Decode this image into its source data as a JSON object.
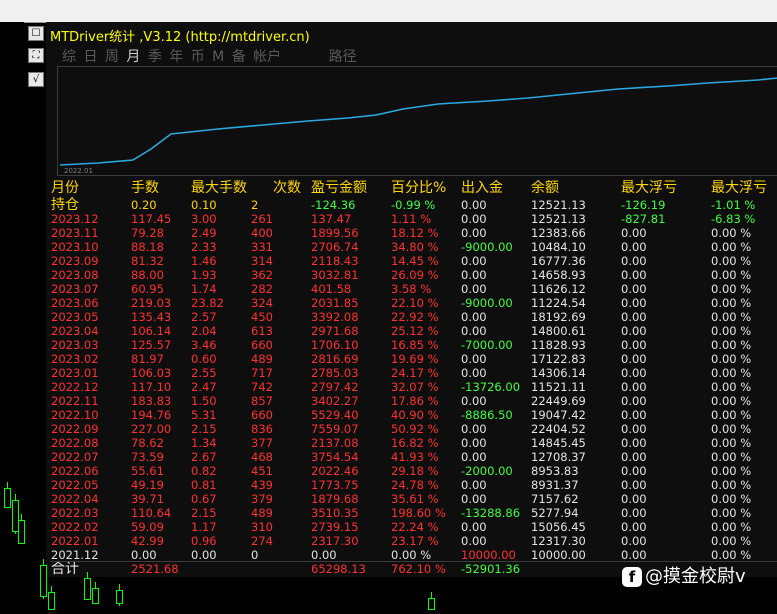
{
  "app": {
    "title": "MTDriver统计 ,V3.12 (http://mtdriver.cn)",
    "side_buttons": [
      "☐",
      "⛶",
      "√"
    ]
  },
  "tabs": [
    {
      "label": "综",
      "active": false
    },
    {
      "label": "日",
      "active": false
    },
    {
      "label": "周",
      "active": false
    },
    {
      "label": "月",
      "active": true
    },
    {
      "label": "季",
      "active": false
    },
    {
      "label": "年",
      "active": false
    },
    {
      "label": "币",
      "active": false
    },
    {
      "label": "M",
      "active": false
    },
    {
      "label": "备",
      "active": false
    },
    {
      "label": "帐户",
      "active": false
    },
    {
      "label": "路径",
      "active": false
    }
  ],
  "equity_chart": {
    "x_start_label": "2022.01",
    "line_color": "#29a9e0"
  },
  "table": {
    "columns": [
      "月份",
      "手数",
      "最大手数",
      "次数",
      "盈亏金额",
      "百分比%",
      "出入金",
      "余额",
      "最大浮亏",
      "最大浮亏"
    ],
    "open_row": {
      "label": "持仓",
      "lots": "0.20",
      "max_lots": "0.10",
      "count": "2",
      "pnl": "-124.36",
      "pct": "-0.99 %",
      "flow": "0.00",
      "balance": "12521.13",
      "max_float_loss": "-126.19",
      "max_float_loss_pct": "-1.01 %"
    },
    "rows": [
      {
        "month": "2023.12",
        "lots": "117.45",
        "max_lots": "3.00",
        "count": "261",
        "pnl": "137.47",
        "pct": "1.11 %",
        "flow": "0.00",
        "balance": "12521.13",
        "mfl": "-827.81",
        "mflp": "-6.83 %"
      },
      {
        "month": "2023.11",
        "lots": "79.28",
        "max_lots": "2.49",
        "count": "400",
        "pnl": "1899.56",
        "pct": "18.12 %",
        "flow": "0.00",
        "balance": "12383.66",
        "mfl": "0.00",
        "mflp": "0.00 %"
      },
      {
        "month": "2023.10",
        "lots": "88.18",
        "max_lots": "2.33",
        "count": "331",
        "pnl": "2706.74",
        "pct": "34.80 %",
        "flow": "-9000.00",
        "balance": "10484.10",
        "mfl": "0.00",
        "mflp": "0.00 %"
      },
      {
        "month": "2023.09",
        "lots": "81.32",
        "max_lots": "1.46",
        "count": "314",
        "pnl": "2118.43",
        "pct": "14.45 %",
        "flow": "0.00",
        "balance": "16777.36",
        "mfl": "0.00",
        "mflp": "0.00 %"
      },
      {
        "month": "2023.08",
        "lots": "88.00",
        "max_lots": "1.93",
        "count": "362",
        "pnl": "3032.81",
        "pct": "26.09 %",
        "flow": "0.00",
        "balance": "14658.93",
        "mfl": "0.00",
        "mflp": "0.00 %"
      },
      {
        "month": "2023.07",
        "lots": "60.95",
        "max_lots": "1.74",
        "count": "282",
        "pnl": "401.58",
        "pct": "3.58 %",
        "flow": "0.00",
        "balance": "11626.12",
        "mfl": "0.00",
        "mflp": "0.00 %"
      },
      {
        "month": "2023.06",
        "lots": "219.03",
        "max_lots": "23.82",
        "count": "324",
        "pnl": "2031.85",
        "pct": "22.10 %",
        "flow": "-9000.00",
        "balance": "11224.54",
        "mfl": "0.00",
        "mflp": "0.00 %"
      },
      {
        "month": "2023.05",
        "lots": "135.43",
        "max_lots": "2.57",
        "count": "450",
        "pnl": "3392.08",
        "pct": "22.92 %",
        "flow": "0.00",
        "balance": "18192.69",
        "mfl": "0.00",
        "mflp": "0.00 %"
      },
      {
        "month": "2023.04",
        "lots": "106.14",
        "max_lots": "2.04",
        "count": "613",
        "pnl": "2971.68",
        "pct": "25.12 %",
        "flow": "0.00",
        "balance": "14800.61",
        "mfl": "0.00",
        "mflp": "0.00 %"
      },
      {
        "month": "2023.03",
        "lots": "125.57",
        "max_lots": "3.46",
        "count": "660",
        "pnl": "1706.10",
        "pct": "16.85 %",
        "flow": "-7000.00",
        "balance": "11828.93",
        "mfl": "0.00",
        "mflp": "0.00 %"
      },
      {
        "month": "2023.02",
        "lots": "81.97",
        "max_lots": "0.60",
        "count": "489",
        "pnl": "2816.69",
        "pct": "19.69 %",
        "flow": "0.00",
        "balance": "17122.83",
        "mfl": "0.00",
        "mflp": "0.00 %"
      },
      {
        "month": "2023.01",
        "lots": "106.03",
        "max_lots": "2.55",
        "count": "717",
        "pnl": "2785.03",
        "pct": "24.17 %",
        "flow": "0.00",
        "balance": "14306.14",
        "mfl": "0.00",
        "mflp": "0.00 %"
      },
      {
        "month": "2022.12",
        "lots": "117.10",
        "max_lots": "2.47",
        "count": "742",
        "pnl": "2797.42",
        "pct": "32.07 %",
        "flow": "-13726.00",
        "balance": "11521.11",
        "mfl": "0.00",
        "mflp": "0.00 %"
      },
      {
        "month": "2022.11",
        "lots": "183.83",
        "max_lots": "1.50",
        "count": "857",
        "pnl": "3402.27",
        "pct": "17.86 %",
        "flow": "0.00",
        "balance": "22449.69",
        "mfl": "0.00",
        "mflp": "0.00 %"
      },
      {
        "month": "2022.10",
        "lots": "194.76",
        "max_lots": "5.31",
        "count": "660",
        "pnl": "5529.40",
        "pct": "40.90 %",
        "flow": "-8886.50",
        "balance": "19047.42",
        "mfl": "0.00",
        "mflp": "0.00 %"
      },
      {
        "month": "2022.09",
        "lots": "227.00",
        "max_lots": "2.15",
        "count": "836",
        "pnl": "7559.07",
        "pct": "50.92 %",
        "flow": "0.00",
        "balance": "22404.52",
        "mfl": "0.00",
        "mflp": "0.00 %"
      },
      {
        "month": "2022.08",
        "lots": "78.62",
        "max_lots": "1.34",
        "count": "377",
        "pnl": "2137.08",
        "pct": "16.82 %",
        "flow": "0.00",
        "balance": "14845.45",
        "mfl": "0.00",
        "mflp": "0.00 %"
      },
      {
        "month": "2022.07",
        "lots": "73.59",
        "max_lots": "2.67",
        "count": "468",
        "pnl": "3754.54",
        "pct": "41.93 %",
        "flow": "0.00",
        "balance": "12708.37",
        "mfl": "0.00",
        "mflp": "0.00 %"
      },
      {
        "month": "2022.06",
        "lots": "55.61",
        "max_lots": "0.82",
        "count": "451",
        "pnl": "2022.46",
        "pct": "29.18 %",
        "flow": "-2000.00",
        "balance": "8953.83",
        "mfl": "0.00",
        "mflp": "0.00 %"
      },
      {
        "month": "2022.05",
        "lots": "49.19",
        "max_lots": "0.81",
        "count": "439",
        "pnl": "1773.75",
        "pct": "24.78 %",
        "flow": "0.00",
        "balance": "8931.37",
        "mfl": "0.00",
        "mflp": "0.00 %"
      },
      {
        "month": "2022.04",
        "lots": "39.71",
        "max_lots": "0.67",
        "count": "379",
        "pnl": "1879.68",
        "pct": "35.61 %",
        "flow": "0.00",
        "balance": "7157.62",
        "mfl": "0.00",
        "mflp": "0.00 %"
      },
      {
        "month": "2022.03",
        "lots": "110.64",
        "max_lots": "2.15",
        "count": "489",
        "pnl": "3510.35",
        "pct": "198.60 %",
        "flow": "-13288.86",
        "balance": "5277.94",
        "mfl": "0.00",
        "mflp": "0.00 %"
      },
      {
        "month": "2022.02",
        "lots": "59.09",
        "max_lots": "1.17",
        "count": "310",
        "pnl": "2739.15",
        "pct": "22.24 %",
        "flow": "0.00",
        "balance": "15056.45",
        "mfl": "0.00",
        "mflp": "0.00 %"
      },
      {
        "month": "2022.01",
        "lots": "42.99",
        "max_lots": "0.96",
        "count": "274",
        "pnl": "2317.30",
        "pct": "23.17 %",
        "flow": "0.00",
        "balance": "12317.30",
        "mfl": "0.00",
        "mflp": "0.00 %"
      },
      {
        "month": "2021.12",
        "lots": "0.00",
        "max_lots": "0.00",
        "count": "0",
        "pnl": "0.00",
        "pct": "0.00 %",
        "flow": "10000.00",
        "balance": "10000.00",
        "mfl": "0.00",
        "mflp": "0.00 %"
      }
    ],
    "total_row": {
      "label": "合计",
      "lots": "2521.68",
      "pnl": "65298.13",
      "pct": "762.10 %",
      "flow": "-52901.36"
    }
  },
  "watermark": {
    "icon": "f",
    "text": "@摸金校尉v"
  },
  "colors": {
    "positive": "#ff3030",
    "negative": "#40ff40",
    "neutral": "#e4e4e4",
    "header": "#ffd700",
    "title": "#ffff00"
  }
}
